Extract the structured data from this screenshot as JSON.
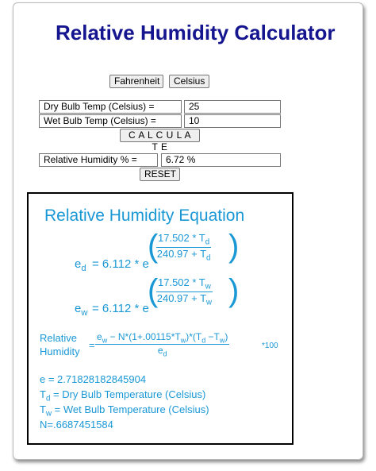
{
  "title": "Relative Humidity Calculator",
  "units": {
    "fahrenheit_label": "Fahrenheit",
    "celsius_label": "Celsius"
  },
  "inputs": {
    "dry_label": "Dry Bulb Temp (Celsius) =",
    "dry_value": "25",
    "wet_label": "Wet Bulb Temp (Celsius) =",
    "wet_value": "10",
    "calculate_label": "C A L C U L A T E"
  },
  "result": {
    "label": "Relative Humidity % =",
    "value": "6.72 %",
    "reset_label": "RESET"
  },
  "equation": {
    "heading": "Relative Humidity Equation",
    "ed_lhs": "e",
    "ed_sub": "d",
    "equals_const": "= 6.112 * e",
    "ed_num": "17.502 * T",
    "ed_num_sub": "d",
    "ed_den": "240.97 + T",
    "ed_den_sub": "d",
    "ew_lhs": "e",
    "ew_sub": "w",
    "ew_num": "17.502 * T",
    "ew_num_sub": "w",
    "ew_den": "240.97 + T",
    "ew_den_sub": "w",
    "rh_word1": "Relative",
    "rh_word2": "Humidity",
    "rh_num_a": "e",
    "rh_num_a_sub": "w",
    "rh_num_b": " − N*(1+.00115*T",
    "rh_num_b_sub": "w",
    "rh_num_c": ")*(T",
    "rh_num_c_sub": "d",
    "rh_num_d": " −T",
    "rh_num_d_sub": "w",
    "rh_num_e": ")",
    "rh_den": "e",
    "rh_den_sub": "d",
    "rh_mult": "*100",
    "def_e": "e = 2.71828182845904",
    "def_td_sym": "T",
    "def_td_sub": "d",
    "def_td_text": "= Dry Bulb Temperature (Celsius)",
    "def_tw_sym": "T",
    "def_tw_sub": "w",
    "def_tw_text": "= Wet Bulb Temperature (Celsius)",
    "def_n": "N=.6687451584"
  },
  "colors": {
    "title": "#14158f",
    "equation": "#1a98d5"
  }
}
